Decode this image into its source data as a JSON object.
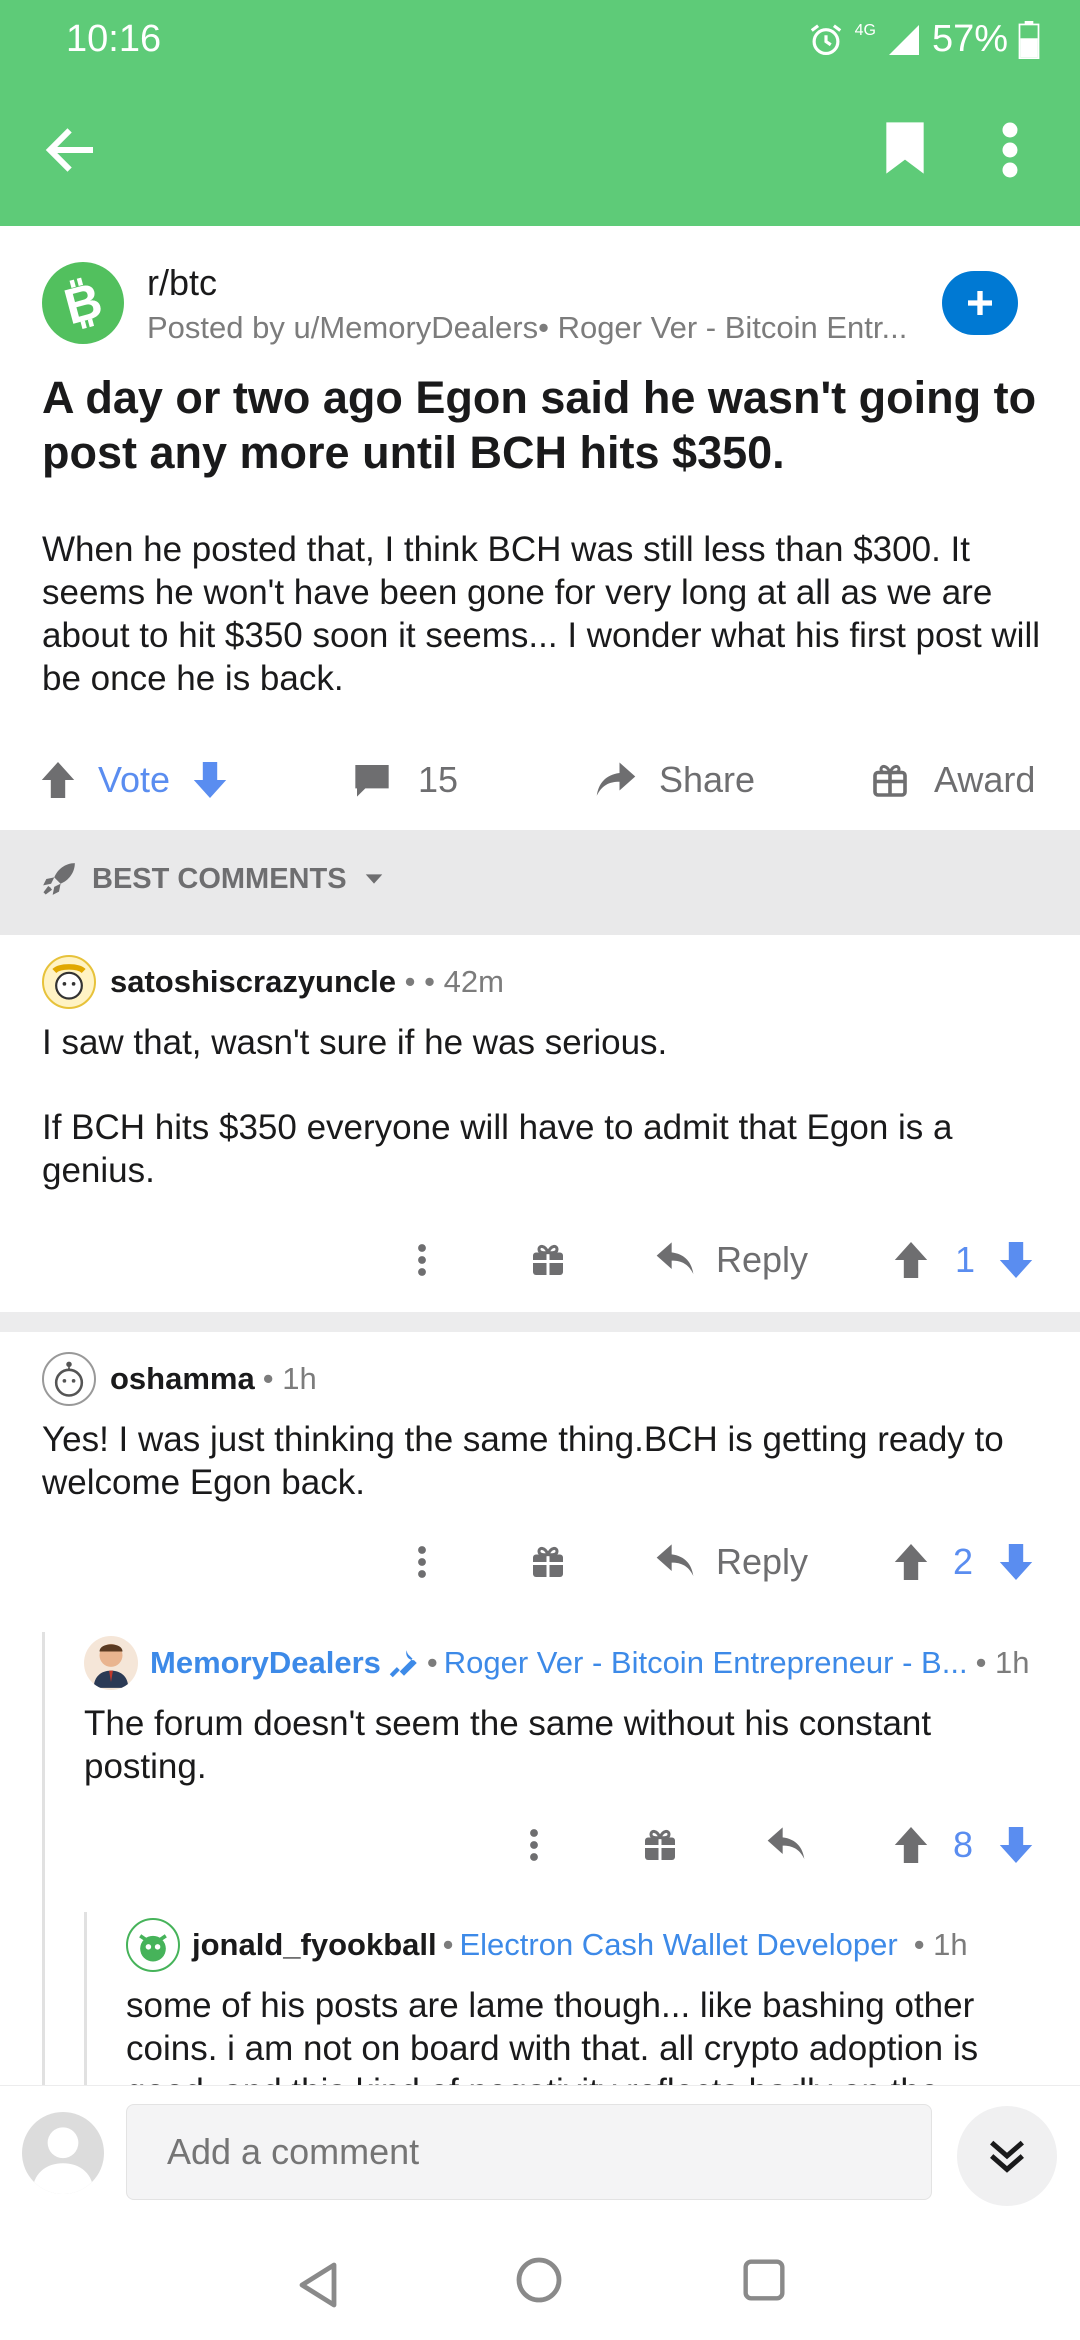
{
  "status_bar": {
    "time": "10:16",
    "network": "4G",
    "battery": "57%"
  },
  "post": {
    "subreddit": "r/btc",
    "posted_by": "Posted by u/MemoryDealers• Roger Ver - Bitcoin Entr...",
    "title": "A day or two ago Egon said he wasn't going to post any more until BCH hits $350.",
    "body": "When he posted that, I think BCH was still less than $300. It seems he won't have been gone for very long at all as we are about to hit $350 soon it seems...  I wonder what his first post will be once he is back.",
    "vote_label": "Vote",
    "comment_count": "15",
    "share_label": "Share",
    "award_label": "Award"
  },
  "sort": {
    "label": "BEST COMMENTS"
  },
  "comments": [
    {
      "author": "satoshiscrazyuncle",
      "flair_sep": " • ",
      "time": "• 42m",
      "text1": "I saw that, wasn't sure if he was serious.",
      "text2": "If BCH hits $350 everyone will have to admit that Egon is a genius.",
      "reply_label": "Reply",
      "score": "1"
    },
    {
      "author": "oshamma",
      "time": "• 1h",
      "text": "Yes! I was just thinking the same thing.BCH is getting ready to welcome Egon back.",
      "reply_label": "Reply",
      "score": "2"
    },
    {
      "author": "MemoryDealers",
      "flair": "Roger Ver - Bitcoin Entrepreneur - B...",
      "time": "• 1h",
      "text": "The forum doesn't seem the same without his constant posting.",
      "score": "8"
    },
    {
      "author": "jonald_fyookball",
      "flair": "Electron Cash Wallet Developer",
      "time": "• 1h",
      "text": "some of his posts are lame though... like bashing other coins.  i am not on board with that.  all crypto adoption is good.  and this kind of negativity reflects badly on the"
    }
  ],
  "comment_box": {
    "placeholder": "Add a comment"
  },
  "colors": {
    "app_bar": "#5ecb78",
    "accent_blue": "#0079d3",
    "vote_blue": "#5a8df0"
  }
}
